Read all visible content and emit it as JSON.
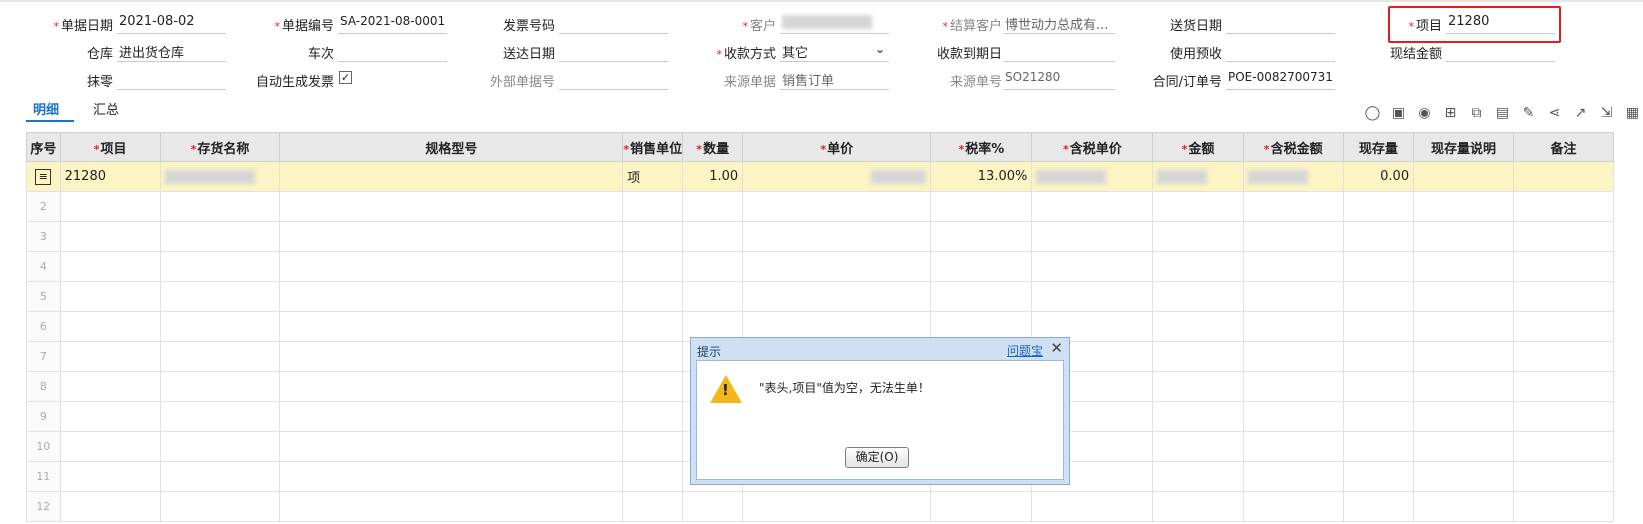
{
  "header": {
    "row1": {
      "doc_date_label": "单据日期",
      "doc_date": "2021-08-02",
      "doc_no_label": "单据编号",
      "doc_no": "SA-2021-08-0001",
      "invoice_no_label": "发票号码",
      "invoice_no": "",
      "customer_label": "客户",
      "customer": "",
      "settle_customer_label": "结算客户",
      "settle_customer": "博世动力总成有...",
      "delivery_date_label": "送货日期",
      "delivery_date": "",
      "project_label": "项目",
      "project": "21280"
    },
    "row2": {
      "warehouse_label": "仓库",
      "warehouse": "进出货仓库",
      "trip_label": "车次",
      "trip": "",
      "arrival_date_label": "送达日期",
      "arrival_date": "",
      "payment_method_label": "收款方式",
      "payment_method": "其它",
      "payment_due_label": "收款到期日",
      "payment_due": "",
      "use_advance_label": "使用预收",
      "use_advance": "",
      "cash_amount_label": "现结金额",
      "cash_amount": ""
    },
    "row3": {
      "rounding_label": "抹零",
      "rounding": "",
      "auto_invoice_label": "自动生成发票",
      "auto_invoice_checked": "✓",
      "external_doc_label": "外部单据号",
      "external_doc": "",
      "source_doc_label": "来源单据",
      "source_doc": "销售订单",
      "source_no_label": "来源单号",
      "source_no": "SO21280",
      "contract_label": "合同/订单号",
      "contract": "POE-0082700731"
    }
  },
  "tabs": {
    "detail": "明细",
    "summary": "汇总"
  },
  "toolbar_icons": [
    "bulb-icon",
    "scan-icon",
    "location-icon",
    "add-row-icon",
    "copy-icon",
    "image-icon",
    "edit-icon",
    "split-icon",
    "chart-icon",
    "export-icon",
    "table-icon"
  ],
  "grid": {
    "columns": {
      "seq": "序号",
      "project": "项目",
      "item_name": "存货名称",
      "spec": "规格型号",
      "unit": "销售单位",
      "qty": "数量",
      "price": "单价",
      "tax_rate": "税率%",
      "taxed_price": "含税单价",
      "amount": "金额",
      "taxed_amount": "含税金额",
      "stock": "现存量",
      "stock_note": "现存量说明",
      "remark": "备注"
    },
    "row1": {
      "project": "21280",
      "unit": "项",
      "qty": "1.00",
      "tax_rate": "13.00%",
      "stock": "0.00"
    },
    "row_numbers": [
      "2",
      "3",
      "4",
      "5",
      "6",
      "7",
      "8",
      "9",
      "10",
      "11",
      "12"
    ]
  },
  "dialog": {
    "title": "提示",
    "help": "问题宝",
    "message": "\"表头,项目\"值为空，无法生单！",
    "ok": "确定(O)"
  },
  "colors": {
    "required": "#e02020",
    "accent": "#1a73c8",
    "selected_row": "#fdf4c4",
    "highlight": "#e02020"
  }
}
